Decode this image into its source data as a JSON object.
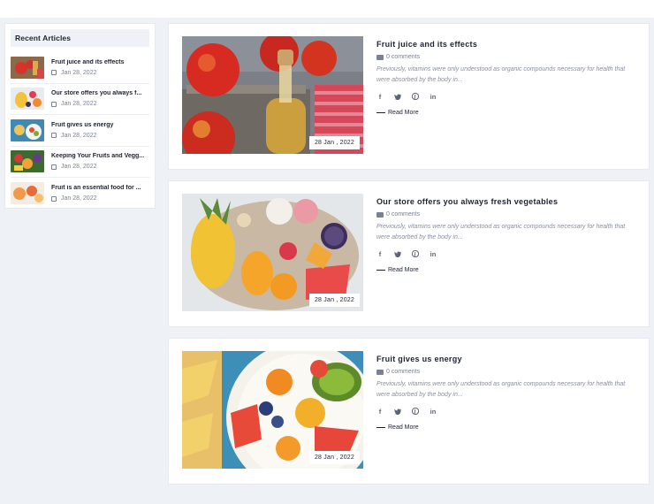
{
  "sidebar": {
    "title": "Recent Articles",
    "items": [
      {
        "title": "Fruit juice and its effects",
        "date": "Jan 28, 2022"
      },
      {
        "title": "Our store offers you always f...",
        "date": "Jan 28, 2022"
      },
      {
        "title": "Fruit gives us energy",
        "date": "Jan 28, 2022"
      },
      {
        "title": "Keeping Your Fruits and Vegg...",
        "date": "Jan 28, 2022"
      },
      {
        "title": "Fruit is an essential food for ...",
        "date": "Jan 28, 2022"
      }
    ]
  },
  "posts": [
    {
      "title": "Fruit juice and its effects",
      "date_badge": "28 Jan , 2022",
      "comments": "0 comments",
      "excerpt": "Previously, vitamins were only understood as organic compounds necessary for health that were absorbed by the body in...",
      "read_more": "Read More"
    },
    {
      "title": "Our store offers you always fresh vegetables",
      "date_badge": "28 Jan , 2022",
      "comments": "0 comments",
      "excerpt": "Previously, vitamins were only understood as organic compounds necessary for health that were absorbed by the body in...",
      "read_more": "Read More"
    },
    {
      "title": "Fruit gives us energy",
      "date_badge": "28 Jan , 2022",
      "comments": "0 comments",
      "excerpt": "Previously, vitamins were only understood as organic compounds necessary for health that were absorbed by the body in...",
      "read_more": "Read More"
    }
  ],
  "social_icons": [
    "facebook-icon",
    "twitter-icon",
    "pinterest-icon",
    "linkedin-icon"
  ],
  "colors": {
    "background": "#eef1f6",
    "card": "#ffffff",
    "text": "#1f2330",
    "muted": "#8a8f9f"
  }
}
